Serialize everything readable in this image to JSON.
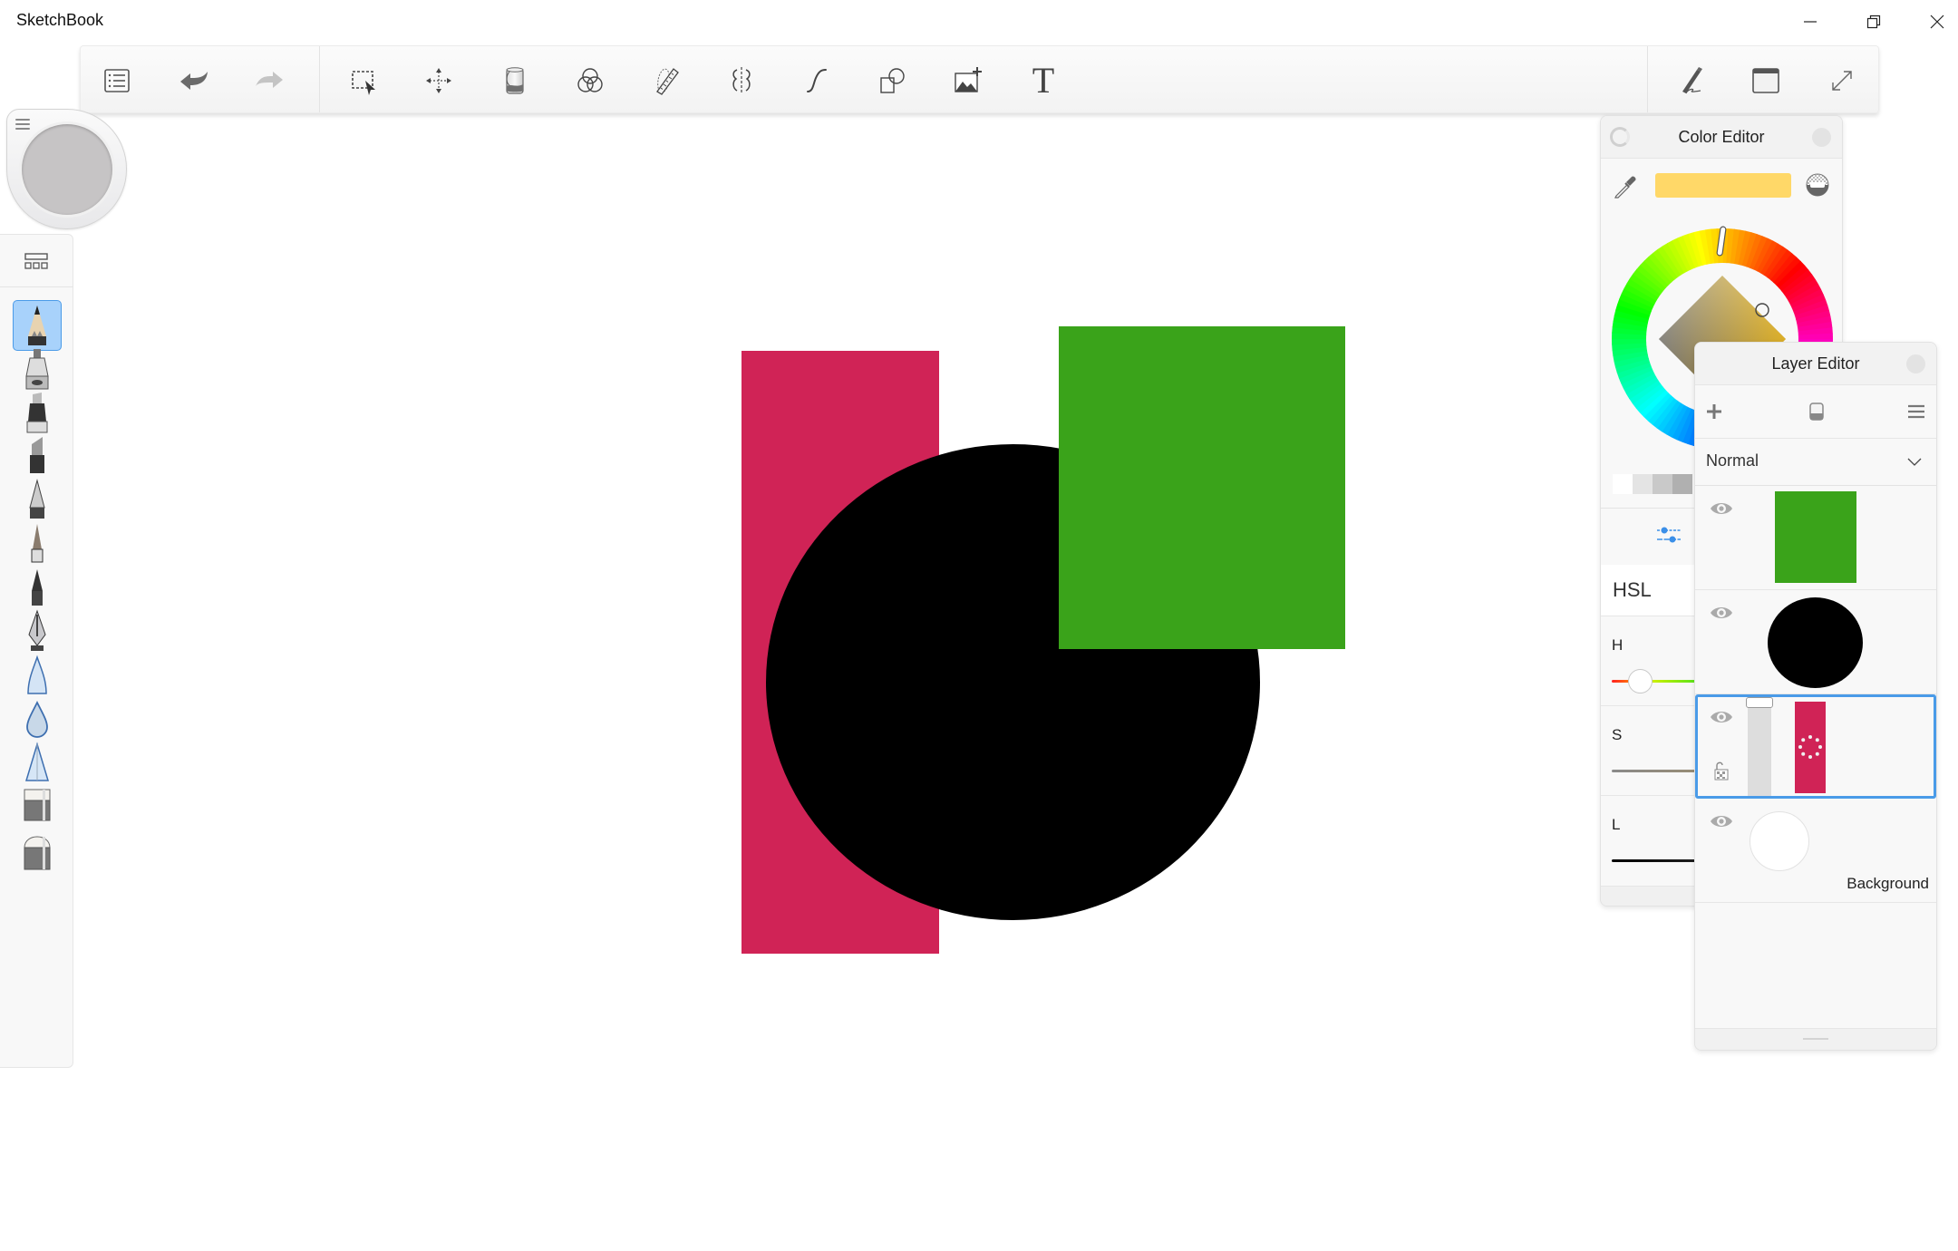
{
  "window": {
    "title": "SketchBook",
    "controls": [
      "minimize",
      "restore",
      "close"
    ]
  },
  "toolbar": {
    "left_items": [
      {
        "name": "toggle-interface",
        "icon": "list-icon"
      },
      {
        "name": "undo",
        "icon": "undo-icon"
      },
      {
        "name": "redo",
        "icon": "redo-icon",
        "disabled": true
      }
    ],
    "tools": [
      {
        "name": "select",
        "icon": "selection-icon"
      },
      {
        "name": "transform",
        "icon": "move-icon"
      },
      {
        "name": "fill",
        "icon": "paint-bucket-icon"
      },
      {
        "name": "color-adjust",
        "icon": "color-circles-icon"
      },
      {
        "name": "ruler",
        "icon": "ruler-icon"
      },
      {
        "name": "symmetry",
        "icon": "symmetry-icon"
      },
      {
        "name": "stroke-tools",
        "icon": "curve-icon"
      },
      {
        "name": "shapes",
        "icon": "shapes-icon"
      },
      {
        "name": "add-image",
        "icon": "add-image-icon"
      },
      {
        "name": "text",
        "icon": "text-icon",
        "glyph": "T"
      }
    ],
    "right_items": [
      {
        "name": "pen-mode",
        "icon": "pen-signature-icon"
      },
      {
        "name": "window-mode",
        "icon": "window-icon"
      },
      {
        "name": "fullscreen",
        "icon": "expand-icon"
      }
    ]
  },
  "brush_puck": {
    "color": "#c6c4c5"
  },
  "brushes": [
    {
      "name": "pencil",
      "selected": true
    },
    {
      "name": "airbrush"
    },
    {
      "name": "marker"
    },
    {
      "name": "chisel-marker"
    },
    {
      "name": "ballpoint-pen"
    },
    {
      "name": "paintbrush"
    },
    {
      "name": "ink-pen"
    },
    {
      "name": "fountain-pen"
    },
    {
      "name": "smear"
    },
    {
      "name": "blur"
    },
    {
      "name": "sharpen"
    },
    {
      "name": "hard-eraser"
    },
    {
      "name": "soft-eraser"
    }
  ],
  "canvas": {
    "background": "#ffffff",
    "shapes": [
      {
        "layer": "red-rect",
        "type": "rect",
        "color": "#d02356"
      },
      {
        "layer": "black-circle",
        "type": "ellipse",
        "color": "#000000"
      },
      {
        "layer": "green-rect",
        "type": "rect",
        "color": "#3aa31a"
      }
    ]
  },
  "color_editor": {
    "title": "Color Editor",
    "current_color": "#ffd868",
    "swatches": [
      "#ffffff",
      "#e4e4e4",
      "#c9c9c9",
      "#b0b0b0"
    ],
    "model": "HSL",
    "sliders": [
      {
        "label": "H",
        "value_fraction": 0.12
      },
      {
        "label": "S"
      },
      {
        "label": "L"
      }
    ]
  },
  "layer_editor": {
    "title": "Layer Editor",
    "blend_mode": "Normal",
    "layers": [
      {
        "name": "",
        "thumb": "green-rect",
        "color": "#3aa31a",
        "visible": true
      },
      {
        "name": "",
        "thumb": "black-circle",
        "color": "#000000",
        "visible": true
      },
      {
        "name": "",
        "thumb": "red-rect",
        "color": "#d02356",
        "visible": true,
        "selected": true,
        "locked": false,
        "opacity": 1.0
      },
      {
        "name": "Background",
        "thumb": "white-circle",
        "color": "#ffffff",
        "visible": true
      }
    ]
  },
  "accent": "#4a9be8"
}
